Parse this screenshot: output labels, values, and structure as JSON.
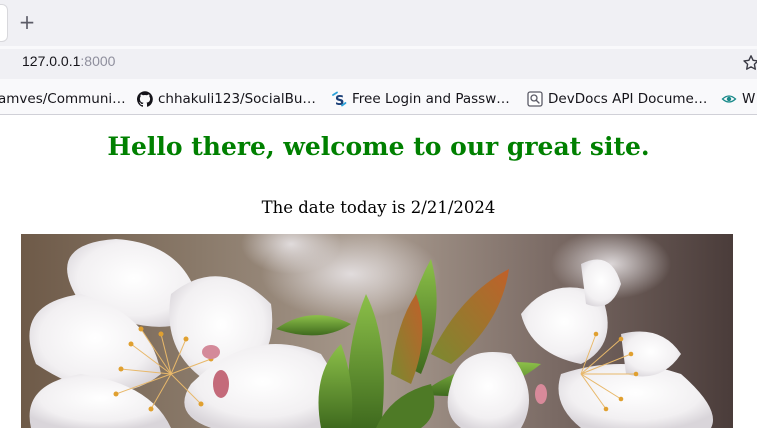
{
  "browser": {
    "new_tab_symbol": "+",
    "address": {
      "host": "127.0.0.1",
      "port": ":8000"
    },
    "bookmarks": [
      {
        "label": "amves/Communi…",
        "icon": "none"
      },
      {
        "label": "chhakuli123/SocialBu…",
        "icon": "github-icon"
      },
      {
        "label": "Free Login and Passw…",
        "icon": "s-logo-icon"
      },
      {
        "label": "DevDocs API Docume…",
        "icon": "search-box-icon"
      },
      {
        "label": "W",
        "icon": "eye-icon"
      }
    ],
    "colors": {
      "tabbar": "#f0f0f4",
      "toolbar": "#f9f9fb"
    }
  },
  "page": {
    "heading": "Hello there, welcome to our great site.",
    "date_text": "The date today is 2/21/2024",
    "heading_color": "#008000"
  }
}
